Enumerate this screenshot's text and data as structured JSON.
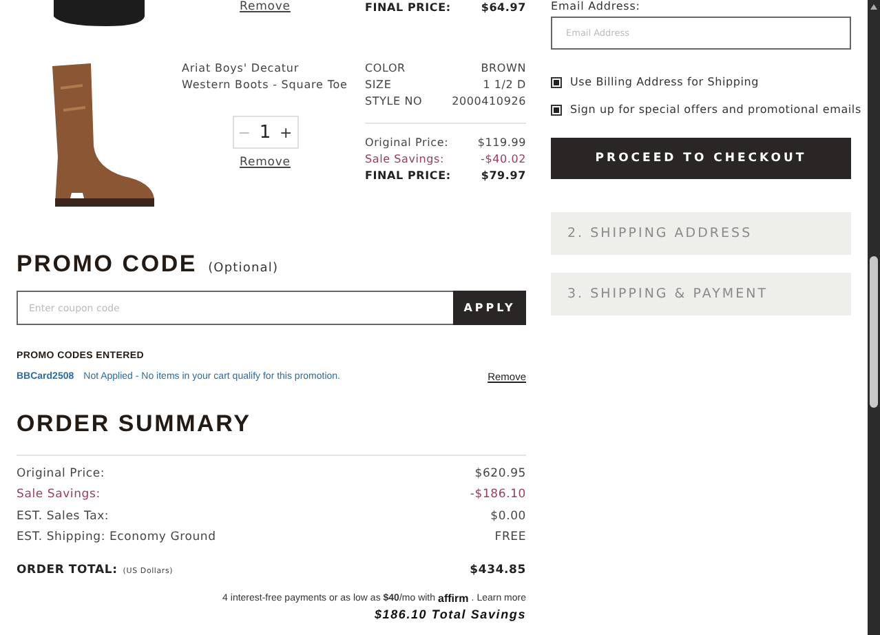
{
  "cart_items": [
    {
      "kind": "partial",
      "remove": "Remove",
      "prices": [
        {
          "kind": "final",
          "label": "FINAL PRICE:",
          "value": "$64.97"
        }
      ]
    },
    {
      "kind": "full",
      "name": "Ariat Boys' Decatur Western Boots - Square Toe",
      "attributes": [
        {
          "label": "COLOR",
          "value": "BROWN"
        },
        {
          "label": "SIZE",
          "value": "1 1/2 D"
        },
        {
          "label": "STYLE NO",
          "value": "2000410926"
        }
      ],
      "qty_minus": "−",
      "quantity": "1",
      "qty_plus": "+",
      "remove": "Remove",
      "prices": [
        {
          "kind": "normal",
          "label": "Original Price:",
          "value": "$119.99"
        },
        {
          "kind": "savings",
          "label": "Sale Savings:",
          "value": "-$40.02"
        },
        {
          "kind": "final",
          "label": "FINAL PRICE:",
          "value": "$79.97"
        }
      ]
    }
  ],
  "promo": {
    "title": "PROMO CODE",
    "optional": "(Optional)",
    "placeholder": "Enter coupon code",
    "button": "APPLY",
    "entered_title": "PROMO CODES ENTERED",
    "entries": [
      {
        "code": "BBCard2508",
        "message": "Not Applied - No items in your cart qualify for this promotion.",
        "remove": "Remove"
      }
    ]
  },
  "summary": {
    "title": "ORDER SUMMARY",
    "lines": [
      {
        "kind": "normal",
        "label": "Original Price:",
        "value": "$620.95"
      },
      {
        "kind": "savings",
        "label": "Sale Savings:",
        "value": "-$186.10"
      },
      {
        "kind": "normal",
        "label": "EST. Sales Tax:",
        "value": "$0.00"
      },
      {
        "kind": "normal",
        "label": "EST. Shipping: Economy Ground",
        "value": "FREE"
      }
    ],
    "total": {
      "label": "ORDER TOTAL:",
      "note": "(US Dollars)",
      "value": "$434.85"
    },
    "affirm": {
      "text": "4 interest-free payments or as low as **$40**/mo with",
      "logo": "affirm",
      "after": ".",
      "link": "Learn more"
    },
    "total_savings": "$186.10 Total Savings"
  },
  "checkout": {
    "email_label": "Email Address:",
    "email_placeholder": "Email Address",
    "options": [
      {
        "label": "Use Billing Address for Shipping",
        "checked": true
      },
      {
        "label": "Sign up for special offers and promotional emails",
        "checked": true
      }
    ],
    "button": "PROCEED TO CHECKOUT",
    "steps": [
      "2. SHIPPING ADDRESS",
      "3. SHIPPING & PAYMENT"
    ]
  }
}
